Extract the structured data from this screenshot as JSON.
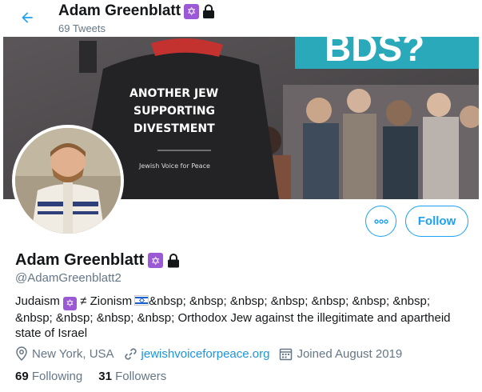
{
  "header": {
    "title": "Adam Greenblatt",
    "tweets_count": "69 Tweets"
  },
  "banner": {
    "shirt_lines": [
      "ANOTHER JEW",
      "SUPPORTING",
      "DIVESTMENT"
    ],
    "shirt_footer": "Jewish Voice for Peace",
    "sign_text": "BDS?"
  },
  "profile": {
    "name": "Adam Greenblatt",
    "handle": "@AdamGreenblatt2",
    "bio_start": "Judaism",
    "bio_mid": "≠ Zionism",
    "bio_rest": "&nbsp; &nbsp; &nbsp; &nbsp; &nbsp; &nbsp; &nbsp; &nbsp; &nbsp; &nbsp; &nbsp; Orthodox Jew against the illegitimate and apartheid state of Israel",
    "location": "New York, USA",
    "website": "jewishvoiceforpeace.org",
    "joined": "Joined August 2019"
  },
  "buttons": {
    "follow": "Follow"
  },
  "stats": {
    "following_count": "69",
    "following_label": "Following",
    "followers_count": "31",
    "followers_label": "Followers"
  },
  "icons": {
    "back": "arrow-left-icon",
    "more": "more-dots-icon",
    "badge": "star-of-david-icon",
    "lock": "lock-icon",
    "location": "map-pin-icon",
    "link": "link-icon",
    "calendar": "calendar-icon"
  },
  "colors": {
    "accent": "#1da1f2",
    "secondary_text": "#657786",
    "badge": "#9b59d6"
  }
}
